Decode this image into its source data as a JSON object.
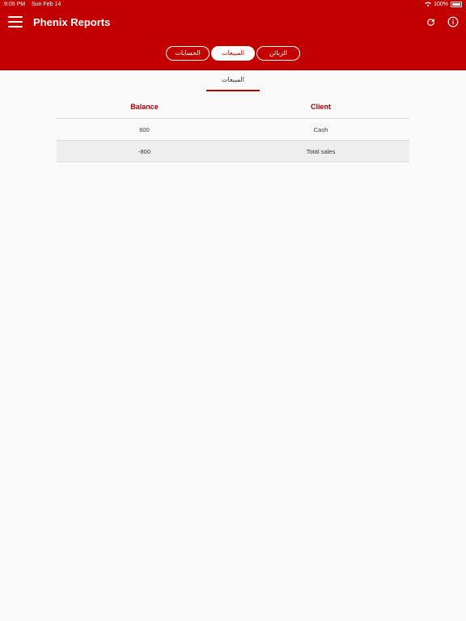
{
  "status_bar": {
    "time": "9:05 PM",
    "date": "Sun Feb 14",
    "battery": "100%"
  },
  "app": {
    "title": "Phenix Reports"
  },
  "icons": {
    "menu": "menu-icon",
    "refresh": "refresh-icon",
    "info": "info-icon"
  },
  "segments": [
    {
      "label": "الحسابات"
    },
    {
      "label": "المبيعات"
    },
    {
      "label": "الزبائن"
    }
  ],
  "sub_tab": {
    "label": "المبيعات"
  },
  "table": {
    "headers": {
      "balance": "Balance",
      "client": "Client"
    },
    "rows": [
      {
        "balance": "600",
        "client": "Cash"
      },
      {
        "balance": "-800",
        "client": "Total sales"
      }
    ]
  },
  "colors": {
    "brand": "#c20000",
    "header_text": "#b00000"
  }
}
